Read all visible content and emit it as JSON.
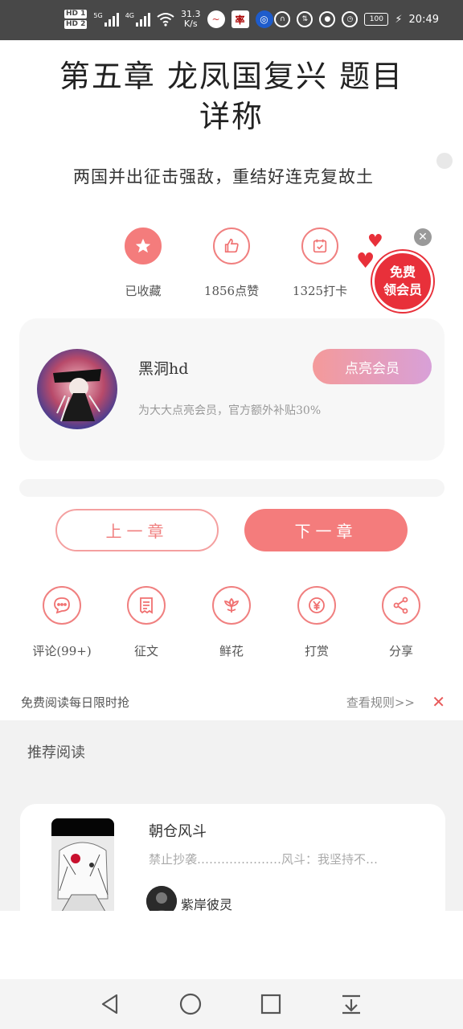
{
  "status_bar": {
    "hd1": "HD 1",
    "hd2": "HD 2",
    "net1": "5G",
    "net2": "4G",
    "speed_value": "31.3",
    "speed_unit": "K/s",
    "app_icon_2": "率",
    "battery": "100",
    "time": "20:49"
  },
  "chapter": {
    "title_line1": "第五章 龙凤国复兴 题目",
    "title_line2": "详称",
    "subtitle": "两国并出征击强敌，重结好连克复故土"
  },
  "actions": {
    "favorite": "已收藏",
    "like": "1856点赞",
    "checkin": "1325打卡"
  },
  "vip_badge": {
    "line1": "免费",
    "line2": "领会员"
  },
  "author": {
    "name": "黑洞hd",
    "light_button": "点亮会员",
    "desc": "为大大点亮会员，官方额外补贴30%"
  },
  "nav_chapters": {
    "prev": "上一章",
    "next": "下一章"
  },
  "tools": [
    {
      "label": "评论(99+)",
      "icon": "comment-icon"
    },
    {
      "label": "征文",
      "icon": "essay-icon"
    },
    {
      "label": "鲜花",
      "icon": "flower-icon"
    },
    {
      "label": "打赏",
      "icon": "reward-icon"
    },
    {
      "label": "分享",
      "icon": "share-icon"
    }
  ],
  "free_strip": {
    "text": "免费阅读每日限时抢",
    "rules": "查看规则>>",
    "close": "✕"
  },
  "recommend": {
    "title": "推荐阅读",
    "book": {
      "name": "朝仓风斗",
      "desc": "禁止抄袭…………………风斗：我坚持不…",
      "author": "紫岸彼灵"
    }
  },
  "colors": {
    "accent": "#f47c7c",
    "status_bar": "#484848",
    "vip_red": "#e8303a"
  }
}
